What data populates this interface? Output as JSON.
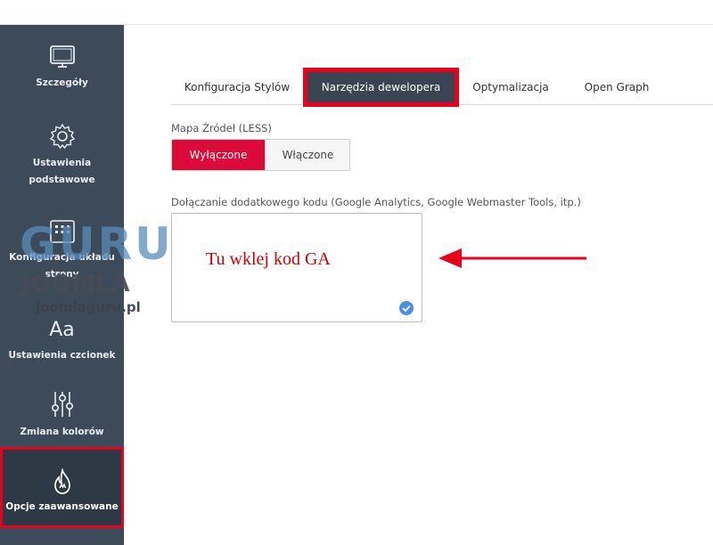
{
  "sidebar": {
    "items": [
      {
        "label": "Szczegóły",
        "icon": "monitor-icon"
      },
      {
        "label": "Ustawienia podstawowe",
        "icon": "gear-icon"
      },
      {
        "label": "Konfiguracja układu strony",
        "icon": "grid-icon"
      },
      {
        "label": "Ustawienia czcionek",
        "icon": "font-icon",
        "glyph": "Aa"
      },
      {
        "label": "Zmiana kolorów",
        "icon": "sliders-icon"
      },
      {
        "label": "Opcje zaawansowane",
        "icon": "flame-icon",
        "active": true
      }
    ]
  },
  "tabs": [
    {
      "label": "Konfiguracja Stylów"
    },
    {
      "label": "Narzędzia dewelopera",
      "active": true
    },
    {
      "label": "Optymalizacja"
    },
    {
      "label": "Open Graph"
    }
  ],
  "source_map": {
    "label": "Mapa Źródeł (LESS)",
    "off_label": "Wyłączone",
    "on_label": "Włączone",
    "selected": "Wyłączone"
  },
  "custom_code": {
    "label": "Dołączanie dodatkowego kodu (Google Analytics, Google Webmaster Tools, itp.)",
    "annotation": "Tu wklej kod GA"
  },
  "watermark": {
    "line1": "GURU",
    "line2": "JOOMLA",
    "url": "joomlaguru.pl"
  },
  "colors": {
    "sidebar_bg": "#3d4a5a",
    "accent_red": "#dc0a38",
    "highlight_red": "#e8001c",
    "active_tab_bg": "#3a4452"
  }
}
